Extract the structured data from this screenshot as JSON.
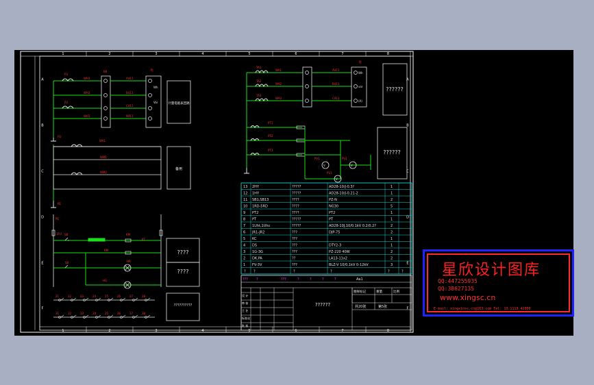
{
  "border": {
    "col_numbers": [
      "1",
      "2",
      "3",
      "4",
      "5",
      "6",
      "7",
      "8"
    ],
    "row_letters": [
      "A",
      "B",
      "C",
      "D",
      "E",
      "F"
    ]
  },
  "left_top": {
    "fu_labels": [
      "FU",
      "FU",
      "FU"
    ],
    "wires": [
      "WH1",
      "WH2",
      "WH3"
    ],
    "block_labels": [
      "KK"
    ],
    "terminal_labels": [
      "①",
      "②",
      "③",
      "④"
    ],
    "meter_texts": [
      "Wh",
      "Var"
    ],
    "box_text": "计量电能表回路"
  },
  "left_mid": {
    "label_pe": "PE",
    "wires": [
      "WM1",
      "WM2"
    ],
    "box_text": "备用"
  },
  "left_bottom": {
    "labels": [
      "PE",
      "1FU",
      "SB",
      "KM",
      "KT",
      "HR",
      "HG"
    ],
    "box1": "????",
    "box2": "????",
    "box3": "??????????",
    "terminal_row1": [
      "21",
      "22",
      "23",
      "24",
      "25",
      "26",
      "27",
      "28"
    ],
    "terminal_row2": [
      "31",
      "32",
      "33",
      "34",
      "35",
      "36",
      "37",
      "38"
    ]
  },
  "right_top": {
    "coil_labels": [
      "TA1",
      "TA2",
      "TA3"
    ],
    "wires": [
      "WA1",
      "WA2",
      "WA3"
    ],
    "meter_labels": [
      "Wh",
      "var",
      "(A)"
    ],
    "box1": "??????",
    "box2": "??????",
    "pt_labels": [
      "PT1",
      "PT2",
      "PT3",
      "PV1",
      "PV2",
      "PV3"
    ]
  },
  "parts_table": {
    "rows": [
      {
        "no": "13",
        "code": "2HY",
        "name": "?????",
        "model": "AD28-10/J-0.3?",
        "qty": "1"
      },
      {
        "no": "12",
        "code": "1HY",
        "name": "?????",
        "model": "AD28-10/J-0.21-2",
        "qty": "1"
      },
      {
        "no": "11",
        "code": "SB1,SB13",
        "name": "????",
        "model": "PZ-N",
        "qty": "2"
      },
      {
        "no": "10",
        "code": "1RD-5RD",
        "name": "????",
        "model": "NG30",
        "qty": "5"
      },
      {
        "no": "9",
        "code": "PT2",
        "name": "????",
        "model": "PT2",
        "qty": "1"
      },
      {
        "no": "8",
        "code": "PT",
        "name": "?????",
        "model": "PT",
        "qty": "1"
      },
      {
        "no": "7",
        "code": "1Uht,1Uhc",
        "name": "?????",
        "model": "AD28-10J,10/0.1kV 0.2/0.2?",
        "qty": "2"
      },
      {
        "no": "6",
        "code": "JR1-JR2",
        "name": "???",
        "model": "DJP-75",
        "qty": "2"
      },
      {
        "no": "5",
        "code": "KC",
        "name": "???",
        "model": "",
        "qty": "1"
      },
      {
        "no": "4",
        "code": "DS",
        "name": "???",
        "model": "DTY2-3",
        "qty": "1"
      },
      {
        "no": "3",
        "code": "1G-3G",
        "name": "???",
        "model": "PZ-220 40W",
        "qty": "2"
      },
      {
        "no": "2",
        "code": "DK,PA",
        "name": "??",
        "model": "LA13-11x2",
        "qty": "2"
      },
      {
        "no": "1",
        "code": "FV-3V",
        "name": "???",
        "model": "BLZ-V 10/0.1kV 0-12kV",
        "qty": "3"
      }
    ],
    "header": [
      "?",
      "?",
      "?",
      "?",
      "?",
      "?"
    ],
    "mark_row": [
      "???",
      "?",
      "???",
      "?",
      "?",
      "?",
      "?",
      "Aa1"
    ],
    "title_block": {
      "drawing_name": "??????",
      "labels": [
        "设 计",
        "审 核",
        "工 艺",
        "标准化",
        "批 准"
      ],
      "right_labels": [
        "图样标记",
        "重量",
        "比例"
      ],
      "sheet": "共20张",
      "page": "第5张"
    }
  },
  "watermark": {
    "title": "星欣设计图库",
    "qq1": "QQ:447255935",
    "qq2": "QQ:38627135",
    "url": "www.xingsc.cn",
    "mail": "E-mail: xingxinsc.cn@163.com  Tel: 13.1113.42000"
  },
  "colors": {
    "frame": "#ffffff",
    "wire_green": "#19e019",
    "label_red": "#ff3030",
    "component_white": "#e8e8e8",
    "table_cyan": "#12d6d6",
    "text_yellow": "#e8e8e8",
    "magenta": "#ff33ff",
    "watermark_red": "#ff2020",
    "watermark_blue": "#1e22ff"
  }
}
